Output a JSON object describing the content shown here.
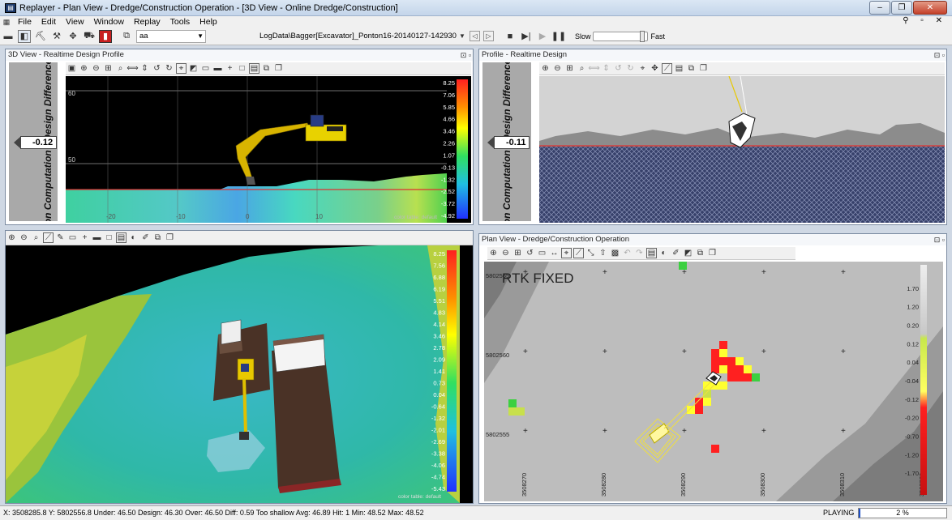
{
  "window": {
    "title": "Replayer - Plan View - Dredge/Construction Operation - [3D View - Online Dredge/Construction]",
    "app_icon": "replayer-icon",
    "controls": [
      "minimize",
      "restore",
      "close"
    ]
  },
  "menu": [
    "File",
    "Edit",
    "View",
    "Window",
    "Replay",
    "Tools",
    "Help"
  ],
  "toolbar": {
    "source_combo": "aa",
    "log_file": "LogData\\Bagger[Excavator]_Ponton16-20140127-142930",
    "speed_slow": "Slow",
    "speed_fast": "Fast",
    "speed": 0.95
  },
  "view3d_profile": {
    "title": "3D View - Realtime Design Profile",
    "vertical_label": "Design Computation - Design Difference",
    "vertical_label_visible": "on Computation - Design Difference",
    "value": "-0.12",
    "y_ticks": [
      "60",
      "50"
    ],
    "x_ticks": [
      "-20",
      "-10",
      "0",
      "10"
    ],
    "scale": [
      "8.25",
      "7.06",
      "5.85",
      "4.66",
      "3.46",
      "2.26",
      "1.07",
      "-0.13",
      "-1.32",
      "-2.52",
      "-3.72",
      "-4.92"
    ],
    "color_table": "color table: default"
  },
  "profile": {
    "title": "Profile - Realtime Design",
    "vertical_label_visible": "on Computation - Design Difference",
    "value": "-0.11"
  },
  "view3d": {
    "scale": [
      "8.25",
      "7.56",
      "6.88",
      "6.19",
      "5.51",
      "4.83",
      "4.14",
      "3.46",
      "2.78",
      "2.09",
      "1.41",
      "0.73",
      "0.04",
      "-0.64",
      "-1.32",
      "-2.01",
      "-2.69",
      "-3.38",
      "-4.06",
      "-4.74",
      "-5.43"
    ],
    "color_table": "color table: default"
  },
  "plan": {
    "title": "Plan View - Dredge/Construction Operation",
    "rtk": "RTK FIXED",
    "y_labels": [
      "5802565",
      "5802560",
      "5802555"
    ],
    "x_labels": [
      "3508270",
      "3508280",
      "3508290",
      "3508300",
      "3508310",
      "3508320"
    ],
    "scale": [
      "",
      "1.70",
      "1.20",
      "0.20",
      "0.12",
      "0.04",
      "-0.04",
      "-0.12",
      "-0.20",
      "-0.70",
      "-1.20",
      "-1.70",
      ""
    ]
  },
  "status": {
    "coords": "X: 3508285.8  Y: 5802556.8  Under: 46.50  Design: 46.30  Over: 46.50  Diff: 0.59  Too shallow  Avg: 46.89  Hit: 1  Min: 48.52  Max: 48.52",
    "state": "PLAYING",
    "progress_label": "2 %",
    "progress": 0.02
  },
  "colors": {
    "accent": "#1e50c8",
    "excavator": "#e8c800",
    "barge": "#5a3a2a",
    "terrain_teal": "#2fb8a8",
    "design_line": "#e03030"
  }
}
